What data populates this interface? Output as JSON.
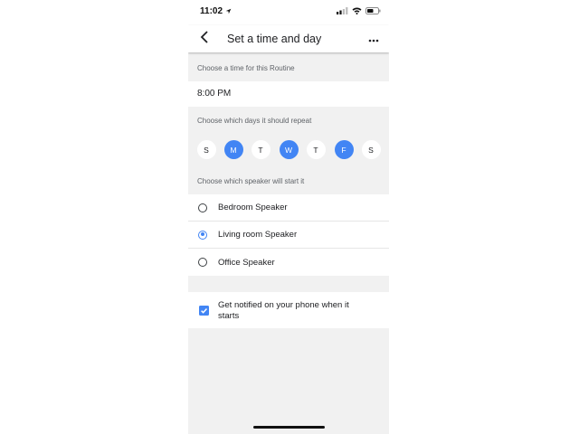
{
  "status_bar": {
    "time": "11:02"
  },
  "header": {
    "title": "Set a time and day"
  },
  "time_section": {
    "label": "Choose a time for this Routine",
    "value": "8:00 PM"
  },
  "days_section": {
    "label": "Choose which days it should repeat",
    "days": [
      {
        "label": "S",
        "selected": false
      },
      {
        "label": "M",
        "selected": true
      },
      {
        "label": "T",
        "selected": false
      },
      {
        "label": "W",
        "selected": true
      },
      {
        "label": "T",
        "selected": false
      },
      {
        "label": "F",
        "selected": true
      },
      {
        "label": "S",
        "selected": false
      }
    ]
  },
  "speaker_section": {
    "label": "Choose which speaker will start it",
    "speakers": [
      {
        "label": "Bedroom Speaker",
        "selected": false
      },
      {
        "label": "Living room Speaker",
        "selected": true
      },
      {
        "label": "Office Speaker",
        "selected": false
      }
    ]
  },
  "notify": {
    "label": "Get notified on your phone when it starts",
    "checked": true
  },
  "colors": {
    "accent": "#4285f4",
    "background": "#f1f1f1"
  }
}
